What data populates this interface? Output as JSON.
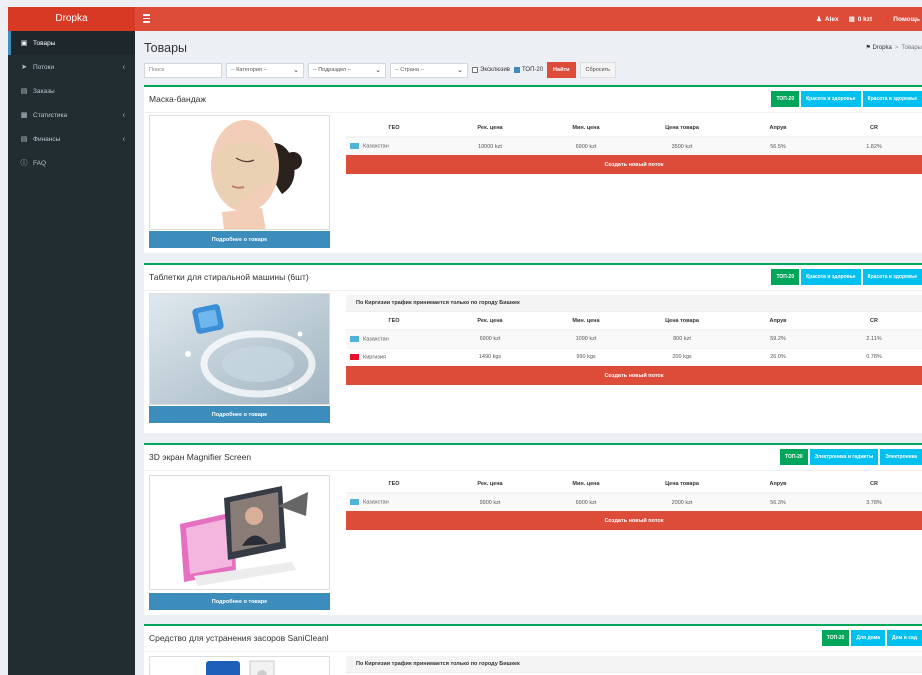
{
  "app": {
    "logo": "Dropka"
  },
  "topbar": {
    "user": "Alex",
    "balance": "0 kzt",
    "help": "Помощь"
  },
  "sidebar": {
    "items": [
      {
        "label": "Товары",
        "icon": "bag-icon"
      },
      {
        "label": "Потоки",
        "icon": "send-icon"
      },
      {
        "label": "Заказы",
        "icon": "cart-icon"
      },
      {
        "label": "Статистика",
        "icon": "bar-chart-icon"
      },
      {
        "label": "Финансы",
        "icon": "money-icon"
      },
      {
        "label": "FAQ",
        "icon": "question-icon"
      }
    ]
  },
  "page": {
    "title": "Товары"
  },
  "breadcrumb": {
    "home": "Dropka",
    "current": "Товары"
  },
  "filters": {
    "search_placeholder": "Поиск",
    "category": "-- Категория --",
    "subsection": "-- Подраздел --",
    "country": "-- Страна --",
    "exclusive_label": "Эксклюзив",
    "top20_label": "ТОП-20",
    "find_label": "Найти",
    "reset_label": "Сбросить"
  },
  "table_headers": [
    "ГЕО",
    "Рек. цена",
    "Мин. цена",
    "Цена товара",
    "Апрув",
    "CR"
  ],
  "more_label": "Подробнее о товаре",
  "create_label": "Создать новый поток",
  "products": [
    {
      "title": "Маска-бандаж",
      "tags": [
        "ТОП-20",
        "Красота и здоровье",
        "Красота и здоровье"
      ],
      "notice": "",
      "rows": [
        {
          "geo": "Казахстан",
          "rec": "10000 kzt",
          "min": "6900 kzt",
          "price": "3500 kzt",
          "approve": "56.5%",
          "cr": "1.82%"
        }
      ]
    },
    {
      "title": "Таблетки для стиральной машины (6шт)",
      "tags": [
        "ТОП-20",
        "Красота и здоровье",
        "Красота и здоровье"
      ],
      "notice": "По Киргизии трафик принимается только по городу Бишкек",
      "rows": [
        {
          "geo": "Казахстан",
          "rec": "6900 kzt",
          "min": "1090 kzt",
          "price": "800 kzt",
          "approve": "59.2%",
          "cr": "2.11%"
        },
        {
          "geo": "Киргизия",
          "rec": "1490 kgs",
          "min": "990 kgs",
          "price": "200 kgs",
          "approve": "26.0%",
          "cr": "0.78%"
        }
      ]
    },
    {
      "title": "3D экран Magnifier Screen",
      "tags": [
        "ТОП-20",
        "Электроника и гаджеты",
        "Электроника"
      ],
      "notice": "",
      "rows": [
        {
          "geo": "Казахстан",
          "rec": "9900 kzt",
          "min": "6900 kzt",
          "price": "2000 kzt",
          "approve": "56.3%",
          "cr": "3.78%"
        }
      ]
    },
    {
      "title": "Средство для устранения засоров SaniCleanl",
      "tags": [
        "ТОП-20",
        "Для дома",
        "Дом и сад"
      ],
      "notice": "По Киргизии трафик принимается только по городу Бишкек",
      "rows": []
    }
  ],
  "colors": {
    "header_red": "#dd4b39",
    "sidebar_dark": "#222d32",
    "accent_green": "#00a65a",
    "accent_blue": "#00c0ef",
    "button_blue": "#3c8dbc"
  }
}
